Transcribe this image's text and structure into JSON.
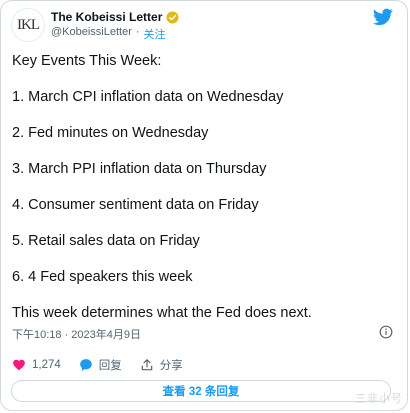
{
  "author": {
    "avatar_text": "IKL",
    "display_name": "The Kobeissi Letter",
    "handle": "@KobeissiLetter",
    "separator": "·",
    "follow_label": "关注"
  },
  "tweet": {
    "lines": [
      "Key Events This Week:",
      "1. March CPI inflation data on Wednesday",
      "2. Fed minutes on Wednesday",
      "3. March PPI inflation data on Thursday",
      "4. Consumer sentiment data on Friday",
      "5. Retail sales data on Friday",
      "6. 4 Fed speakers this week",
      "This week determines what the Fed does next."
    ],
    "timestamp": "下午10:18 · 2023年4月9日"
  },
  "actions": {
    "like_count": "1,274",
    "reply_label": "回复",
    "share_label": "分享"
  },
  "replies_button": {
    "label": "查看 32 条回复"
  },
  "watermark": {
    "text": "三非小号"
  },
  "colors": {
    "accent": "#1d9bf0",
    "like": "#f91880",
    "verified_badge": "#e2b719",
    "text_primary": "#0f1419",
    "text_secondary": "#536471"
  }
}
